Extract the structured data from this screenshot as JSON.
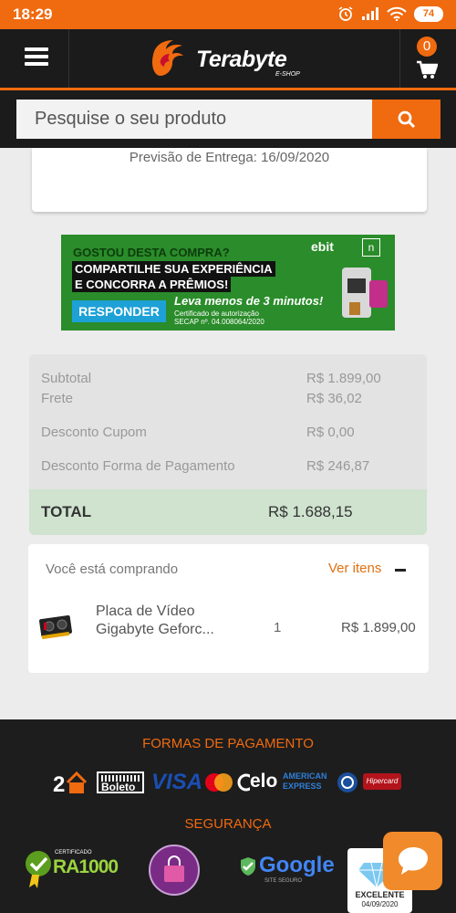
{
  "status_bar": {
    "time": "18:29",
    "battery": "74"
  },
  "header": {
    "logo_text": "Terabyte",
    "logo_sub": "E-SHOP",
    "cart_count": "0"
  },
  "search": {
    "placeholder": "Pesquise o seu produto"
  },
  "delivery": {
    "text": "Previsão de Entrega: 16/09/2020"
  },
  "banner": {
    "question": "GOSTOU DESTA COMPRA?",
    "line1": "COMPARTILHE SUA EXPERIÊNCIA",
    "line2": "E CONCORRA A PRÊMIOS!",
    "respond": "RESPONDER",
    "time_note": "Leva menos de 3 minutos!",
    "cert": "Certificado de autorização SECAP nº. 04.008064/2020",
    "brand": "ebit",
    "box": "n"
  },
  "summary": {
    "subtotal_label": "Subtotal",
    "subtotal_value": "R$ 1.899,00",
    "frete_label": "Frete",
    "frete_value": "R$ 36,02",
    "cupom_label": "Desconto Cupom",
    "cupom_value": "R$ 0,00",
    "pagamento_label": "Desconto Forma de Pagamento",
    "pagamento_value": "R$ 246,87",
    "total_label": "TOTAL",
    "total_value": "R$ 1.688,15"
  },
  "buying": {
    "title": "Você está comprando",
    "ver_itens": "Ver itens",
    "item": {
      "name_line1": "Placa de Vídeo",
      "name_line2": "Gigabyte Geforc...",
      "qty": "1",
      "price": "R$ 1.899,00"
    }
  },
  "footer": {
    "payment_title": "FORMAS DE PAGAMENTO",
    "payment_methods": [
      "Boleto",
      "VISA",
      "elo",
      "AMERICAN EXPRESS",
      "Hipercard"
    ],
    "security_title": "SEGURANÇA",
    "security": {
      "ra_top": "CERTIFICADO",
      "ra_main": "RA1000",
      "google": "Google",
      "google_sub": "SITE SEGURO",
      "ebit_label": "EXCELENTE",
      "ebit_date": "04/09/2020"
    }
  },
  "colors": {
    "accent": "#f06a0f",
    "dark": "#1b1b1b",
    "total_bg": "#cfe3cf"
  }
}
